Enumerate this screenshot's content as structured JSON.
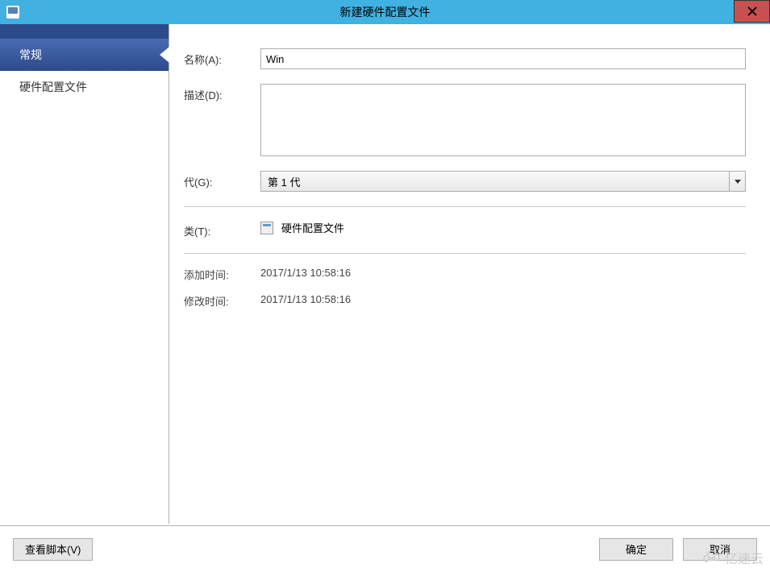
{
  "window": {
    "title": "新建硬件配置文件"
  },
  "sidebar": {
    "items": [
      {
        "label": "常规",
        "active": true
      },
      {
        "label": "硬件配置文件",
        "active": false
      }
    ]
  },
  "form": {
    "name_label": "名称(A):",
    "name_value": "Win",
    "description_label": "描述(D):",
    "description_value": "",
    "generation_label": "代(G):",
    "generation_value": "第 1 代",
    "type_label": "类(T):",
    "type_value": "硬件配置文件",
    "added_label": "添加时间:",
    "added_value": "2017/1/13 10:58:16",
    "modified_label": "修改时间:",
    "modified_value": "2017/1/13 10:58:16"
  },
  "buttons": {
    "view_script": "查看脚本(V)",
    "ok": "确定",
    "cancel": "取消"
  },
  "watermark": {
    "text": "亿速云"
  }
}
